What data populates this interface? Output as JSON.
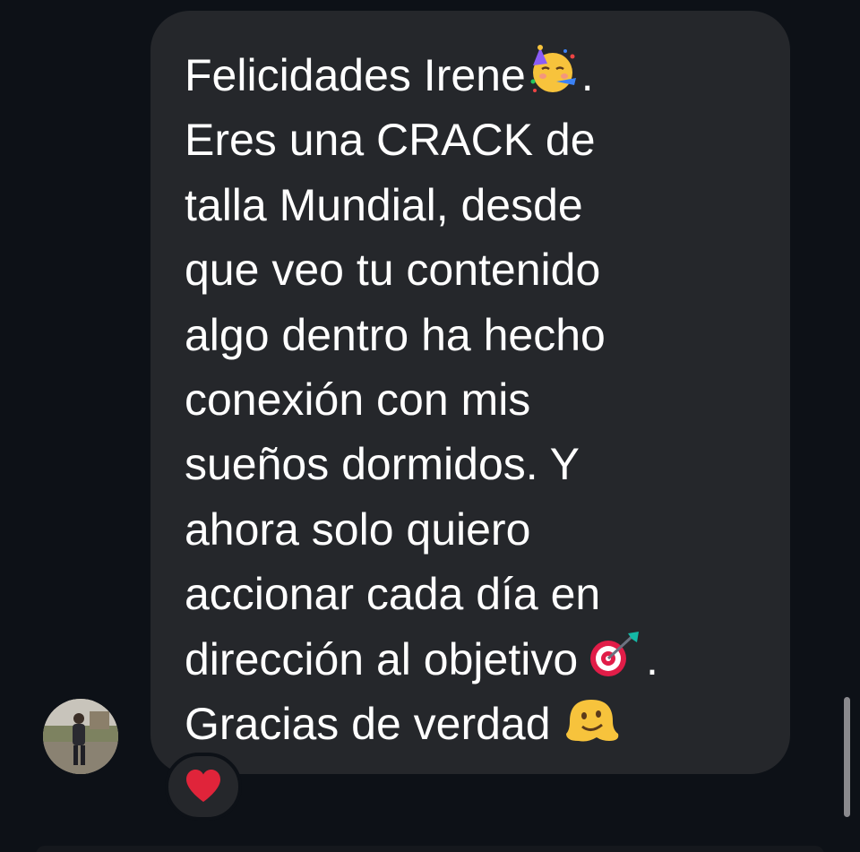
{
  "message": {
    "lines": {
      "l1": "Felicidades Irene",
      "l1_end": ".",
      "l2": "Eres una CRACK de",
      "l3": "talla Mundial, desde",
      "l4": "que veo tu contenido",
      "l5": "algo dentro ha hecho",
      "l6": "conexión con mis",
      "l7": "sueños dormidos. Y",
      "l8": "ahora solo quiero",
      "l9": "accionar cada día en",
      "l10": "dirección al objetivo ",
      "l10_end": ".",
      "l11": "Gracias de verdad "
    },
    "emojis": [
      "partying-face-icon",
      "target-dart-icon",
      "melting-face-icon"
    ]
  },
  "reaction": {
    "icon": "red-heart-icon",
    "color": "#e0243a"
  },
  "colors": {
    "background": "#0d1117",
    "bubble": "#25272b",
    "text": "#ffffff"
  }
}
